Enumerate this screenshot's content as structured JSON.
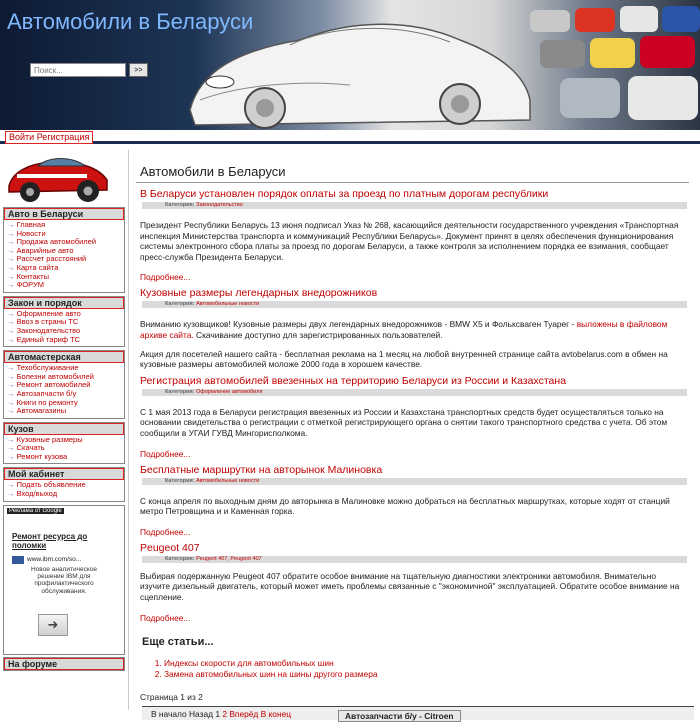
{
  "header": {
    "title": "Автомобили в Беларуси",
    "search_placeholder": "Поиск...",
    "search_button": ">>"
  },
  "login": {
    "login": "Войти",
    "register": "Регистрация"
  },
  "sidebar": {
    "blocks": [
      {
        "title": "Авто в Беларуси",
        "items": [
          "Главная",
          "Новости",
          "Продажа автомобилей",
          "Аварийные авто",
          "Рассчет расстояний",
          "Карта сайта",
          "Контакты",
          "ФОРУМ"
        ]
      },
      {
        "title": "Закон и порядок",
        "items": [
          "Оформление авто",
          "Ввоз в страны ТС",
          "Законодательство",
          "Единый тариф ТС"
        ]
      },
      {
        "title": "Автомастерская",
        "items": [
          "Техобслуживание",
          "Болезни автомобилей",
          "Ремонт автомобилей",
          "Автозапчасти б/у",
          "Книги по ремонту",
          "Автомагазины"
        ]
      },
      {
        "title": "Кузов",
        "items": [
          "Кузовные размеры",
          "Скачать",
          "Ремонт кузова"
        ]
      },
      {
        "title": "Мой кабинет",
        "items": [
          "Подать объявление",
          "Вход/выход"
        ]
      }
    ],
    "ad": {
      "label": "Реклама от Google",
      "title": "Ремонт ресурса до поломки",
      "url": "www.ibm.com/so...",
      "text": "Новое аналитическое решение IBM для профилактического обслуживания.",
      "arrow": "➜"
    },
    "forum_title": "На форуме"
  },
  "main": {
    "page_title": "Автомобили в Беларуси",
    "category_label": "Категория:",
    "more_label": "Подробнее...",
    "articles": [
      {
        "title": "В Беларуси установлен порядок оплаты за проезд по платным дорогам республики",
        "category": "Законодательство",
        "body": "Президент Республики Беларусь 13 июня подписал Указ № 268, касающийся деятельности государственного учреждения «Транспортная инспекция Министерства транспорта и коммуникаций Республики Беларусь». Документ принят в целях обеспечения функционирования системы электронного сбора платы за проезд по дорогам Беларуси, а также контроля за исполнением порядка ее взимания, сообщает пресс-служба Президента Беларуси."
      },
      {
        "title": "Кузовные размеры легендарных внедорожников",
        "category": "Автомобильные новости",
        "body1": "Вниманию кузовщиков! Кузовные размеры двух легендарных внедорожников - BMW X5 и Фольксваген Туарег -",
        "highlight": "выложены в файловом архиве сайта.",
        "body2": "Скачивание доступно для зарегистрированных пользователей.",
        "body3": "Акция для посетелей нашего сайта - бесплатная реклама на 1 месяц на любой внутренней странице сайта avtobelarus.com в обмен на кузовные размеры автомобилей моложе 2000 года в хорошем качестве."
      },
      {
        "title": "Регистрация автомобилей ввезенных на территорию Беларуси из России и Казахстана",
        "category": "Оформление автомобиля",
        "body": "С 1 мая 2013 года в Беларуси регистрация ввезенных из России и Казахстана транспортных средств будет осуществляться только на основании свидетельства о регистрации с отметкой регистрирующего органа о снятии такого транспортного средства с учета. Об этом сообщили в УГАИ ГУВД Мингорисполкома."
      },
      {
        "title": "Бесплатные маршрутки на авторынок Малиновка",
        "category": "Автомобильные новости",
        "body": "С конца апреля по выходным дням до авторынка в Малиновке можно добраться на бесплатных маршрутках, которые ходят от станций метро Петровщина и и Каменная горка."
      },
      {
        "title": "Peugeot 407",
        "category": "Peugeot 407, Peugeot 407",
        "body": "Выбирая подержанную Peugeot 407 обратите особое внимание на тщательную диагностики электроники автомобиля. Внимательно изучите дизельный двигатель, который может иметь проблемы связанные с \"экономичной\" эксплуатацией. Обратите особое внимание на сцепление."
      }
    ],
    "more_articles_title": "Еще статьи...",
    "more_articles": [
      "Индексы скорости для автомобильных шин",
      "Замена автомобильных шин на шины другого размера"
    ],
    "pages_text": "Страница 1 из 2"
  },
  "pager": {
    "start": "В начало",
    "prev": "Назад",
    "p1": "1",
    "p2": "2",
    "next": "Вперёд",
    "end": "В конец",
    "tab": "Автозапчасти б/у - Citroen"
  }
}
